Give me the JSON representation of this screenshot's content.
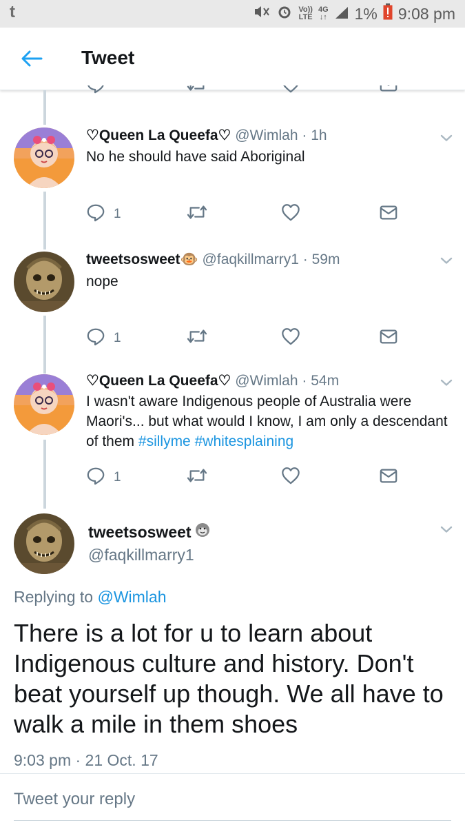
{
  "status_bar": {
    "app_glyph": "t",
    "volte_top": "Vo))",
    "volte_bottom": "LTE",
    "network_top": "4G",
    "network_bottom": "↓↑",
    "battery": "1%",
    "time": "9:08 pm"
  },
  "app_bar": {
    "title": "Tweet"
  },
  "thread": [
    {
      "name": "♡Queen La Queefa♡",
      "handle": "@Wimlah",
      "time": "1h",
      "text": "No he should have said Aboriginal",
      "reply_count": "1"
    },
    {
      "name": "tweetsosweet🐵",
      "handle": "@faqkillmarry1",
      "time": "59m",
      "text": "nope",
      "reply_count": "1"
    },
    {
      "name": "♡Queen La Queefa♡",
      "handle": "@Wimlah",
      "time": "54m",
      "text_plain": "I wasn't aware Indigenous people of Australia were Maori's... but what would I know, I am only a descendant of them",
      "hashtags": [
        "#sillyme",
        "#whitesplaining"
      ],
      "reply_count": "1"
    }
  ],
  "main_tweet": {
    "name": "tweetsosweet",
    "handle": "@faqkillmarry1",
    "replying_prefix": "Replying to",
    "replying_to": "@Wimlah",
    "text": "There is a lot for u to learn about Indigenous culture and history. Don't beat yourself up though. We all have to walk a mile in them shoes",
    "timestamp": "9:03 pm · 21 Oct. 17"
  },
  "reply_box": {
    "placeholder": "Tweet your reply"
  },
  "icons": {
    "back": "arrow-left-icon",
    "reply": "reply-icon",
    "retweet": "retweet-icon",
    "like": "heart-icon",
    "dm": "envelope-icon",
    "caret": "chevron-down-icon",
    "monkey": "monkey-emoji-icon"
  },
  "colors": {
    "accent": "#1da1f2",
    "link": "#1b95e0",
    "secondary_text": "#657786",
    "thread_line": "#ccd6dd",
    "status_bar_bg": "#e9e9e9",
    "battery_warning": "#e0452c"
  }
}
